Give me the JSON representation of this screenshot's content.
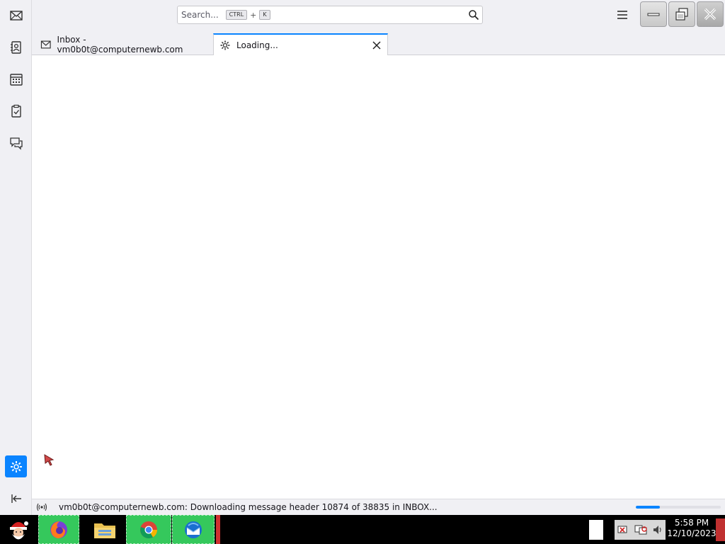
{
  "search": {
    "placeholder": "Search...",
    "key1": "CTRL",
    "plus": "+",
    "key2": "K"
  },
  "tabs": [
    {
      "label": "Inbox - vm0b0t@computernewb.com",
      "icon": "mail-icon"
    },
    {
      "label": "Loading...",
      "icon": "gear-icon",
      "active": true
    }
  ],
  "status": {
    "text": "vm0b0t@computernewb.com: Downloading message header 10874 of 38835 in INBOX...",
    "progress": 0.28
  },
  "taskbar": {
    "time": "5:58 PM",
    "date": "12/10/2023"
  },
  "colors": {
    "accent": "#0a84ff",
    "taskbar": "#000000",
    "task_highlight": "#35c85c"
  }
}
